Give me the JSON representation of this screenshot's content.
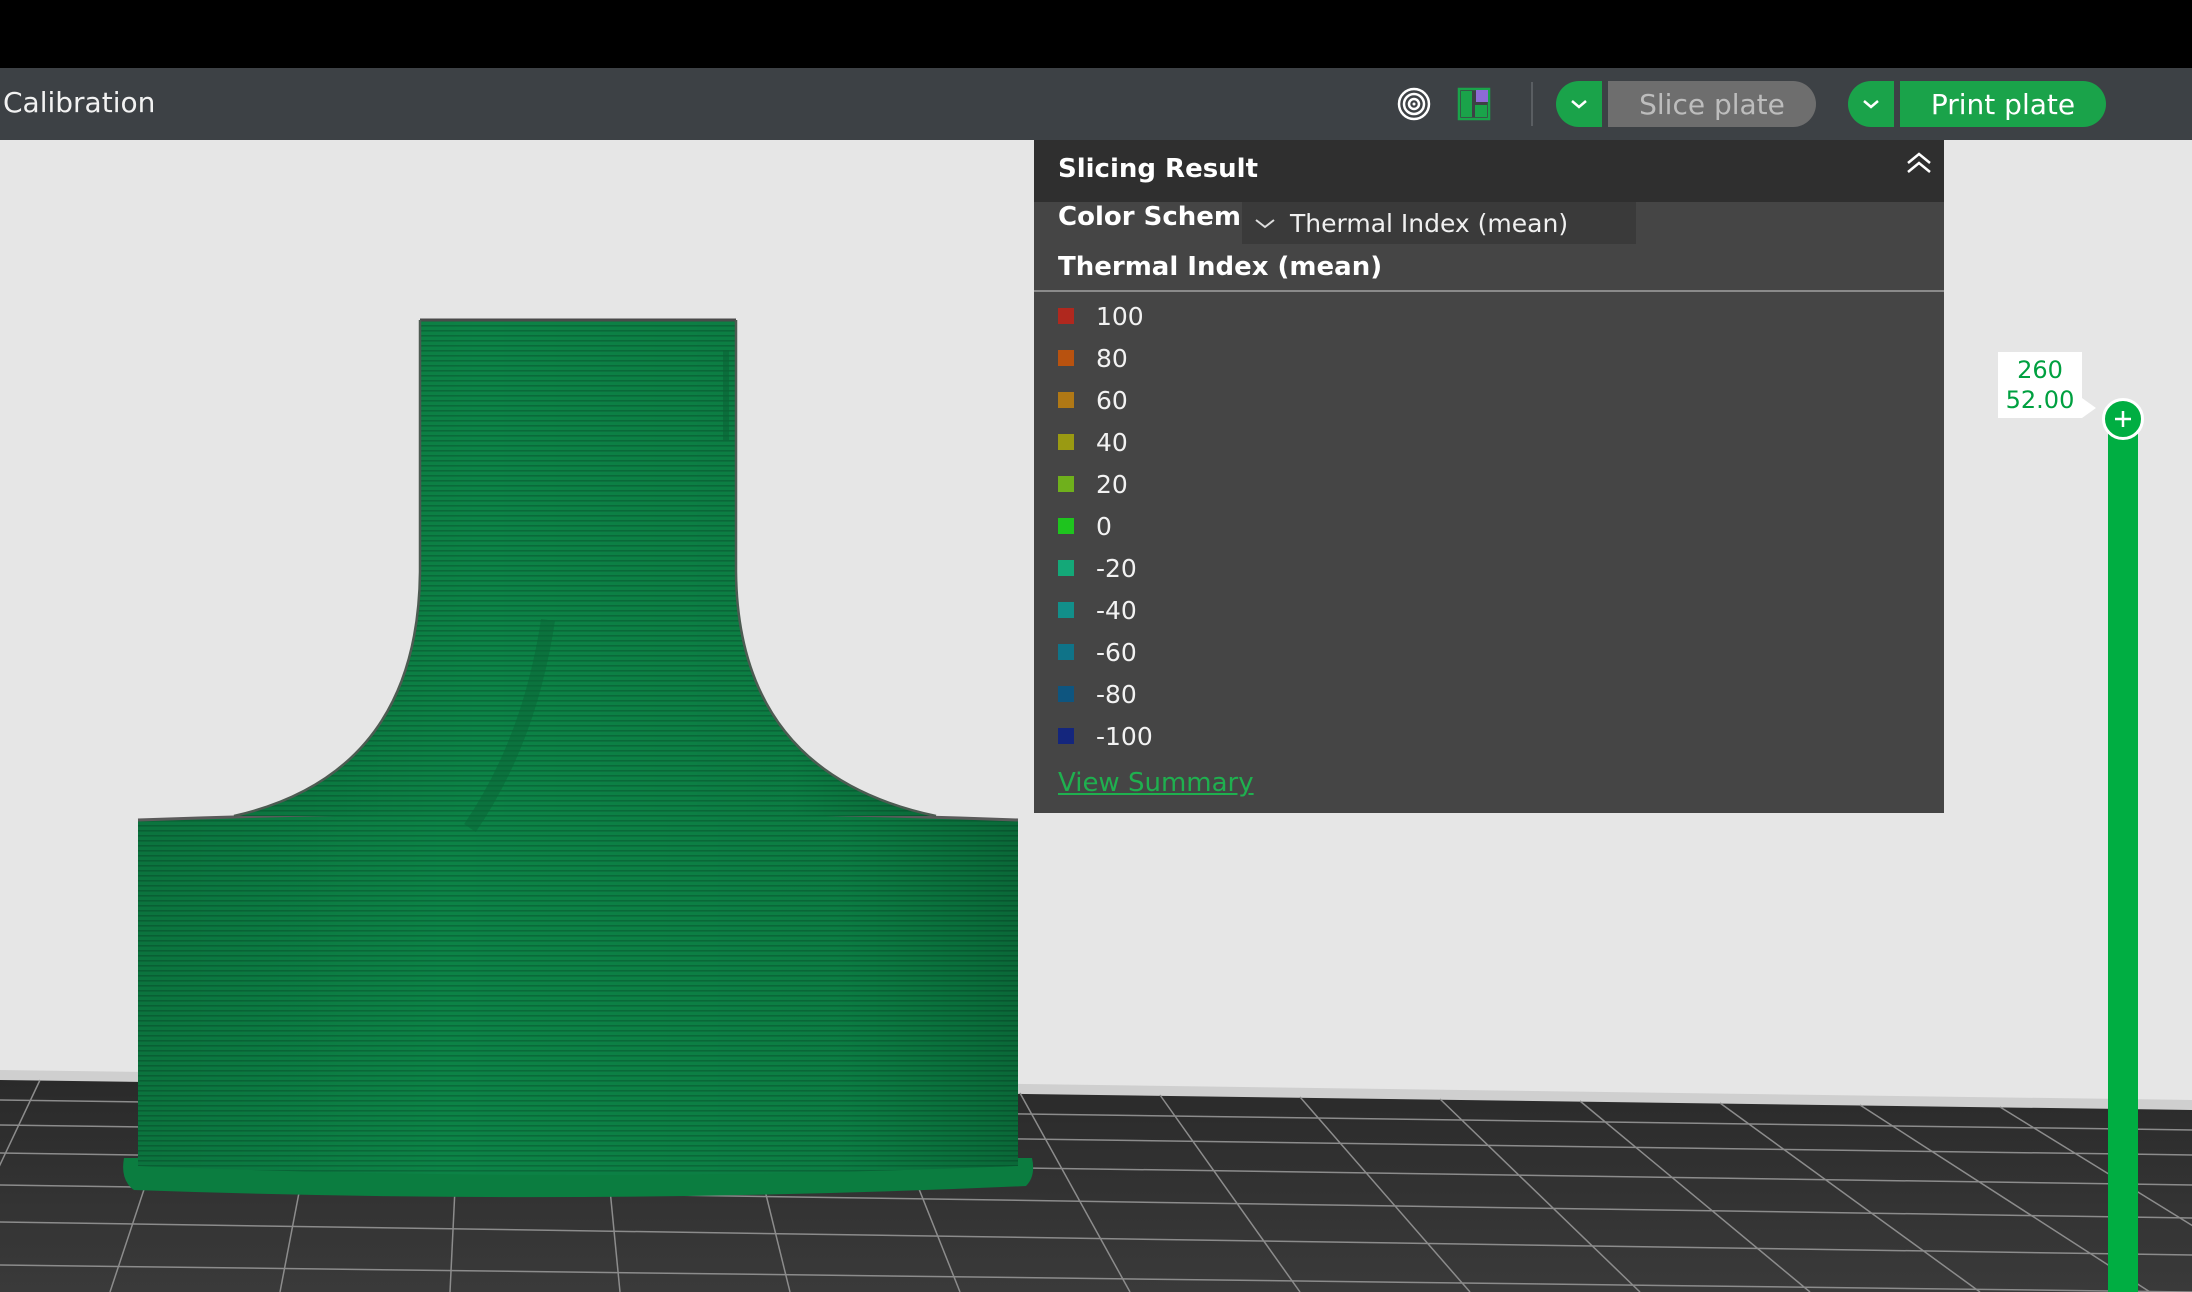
{
  "toolbar": {
    "menu_label": "Calibration",
    "icons": [
      "target-icon",
      "layout-icon"
    ],
    "slice_label": "Slice plate",
    "print_label": "Print plate"
  },
  "panel": {
    "title": "Slicing Result",
    "color_scheme_label": "Color Scheme",
    "color_scheme_value": "Thermal Index (mean)",
    "legend_title": "Thermal Index (mean)",
    "legend": [
      {
        "value": "100",
        "color": "#b0281e"
      },
      {
        "value": "80",
        "color": "#b8520f"
      },
      {
        "value": "60",
        "color": "#b07815"
      },
      {
        "value": "40",
        "color": "#9a9a12"
      },
      {
        "value": "20",
        "color": "#6fb01c"
      },
      {
        "value": "0",
        "color": "#1ec41e"
      },
      {
        "value": "-20",
        "color": "#14a878"
      },
      {
        "value": "-40",
        "color": "#128f8a"
      },
      {
        "value": "-60",
        "color": "#0f7388"
      },
      {
        "value": "-80",
        "color": "#0e557f"
      },
      {
        "value": "-100",
        "color": "#14267d"
      }
    ],
    "view_summary": "View Summary"
  },
  "layer_slider": {
    "layer": "260",
    "height": "52.00"
  },
  "colors": {
    "accent": "#00ae42",
    "model": "#0e8a4a",
    "panel_bg": "#454545"
  }
}
